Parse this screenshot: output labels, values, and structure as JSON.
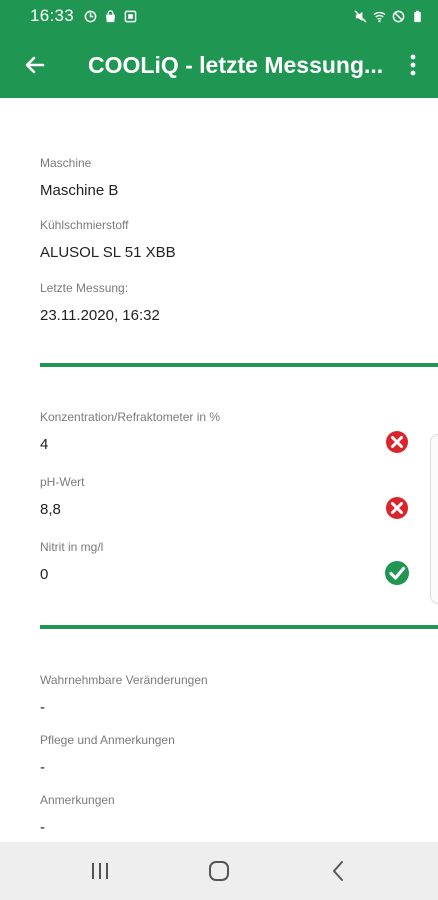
{
  "status_bar": {
    "time": "16:33",
    "left_icons": [
      "sync-icon",
      "shopping-bag-icon",
      "photo-icon"
    ],
    "right_icons": [
      "mute-icon",
      "wifi-icon",
      "do-not-disturb-icon",
      "battery-icon"
    ]
  },
  "app_bar": {
    "title": "COOLiQ - letzte Messung...",
    "color": "#1f9752"
  },
  "info": {
    "machine_label": "Maschine",
    "machine_value": "Maschine B",
    "coolant_label": "Kühlschmierstoff",
    "coolant_value": "ALUSOL SL 51 XBB",
    "last_label": "Letzte Messung:",
    "last_value": "23.11.2020, 16:32"
  },
  "measurements": [
    {
      "label": "Konzentration/Refraktometer in %",
      "value": "4",
      "status": "error",
      "status_icon": "error-icon",
      "status_color": "#d9262c"
    },
    {
      "label": "pH-Wert",
      "value": "8,8",
      "status": "error",
      "status_icon": "error-icon",
      "status_color": "#d9262c"
    },
    {
      "label": "Nitrit in mg/l",
      "value": "0",
      "status": "ok",
      "status_icon": "check-icon",
      "status_color": "#1f9752"
    }
  ],
  "notes": [
    {
      "label": "Wahrnehmbare Veränderungen",
      "value": "-"
    },
    {
      "label": "Pflege und Anmerkungen",
      "value": "-"
    },
    {
      "label": "Anmerkungen",
      "value": "-"
    }
  ],
  "nav_bar": {
    "buttons": [
      "recent-apps-icon",
      "home-icon",
      "back-icon"
    ]
  }
}
